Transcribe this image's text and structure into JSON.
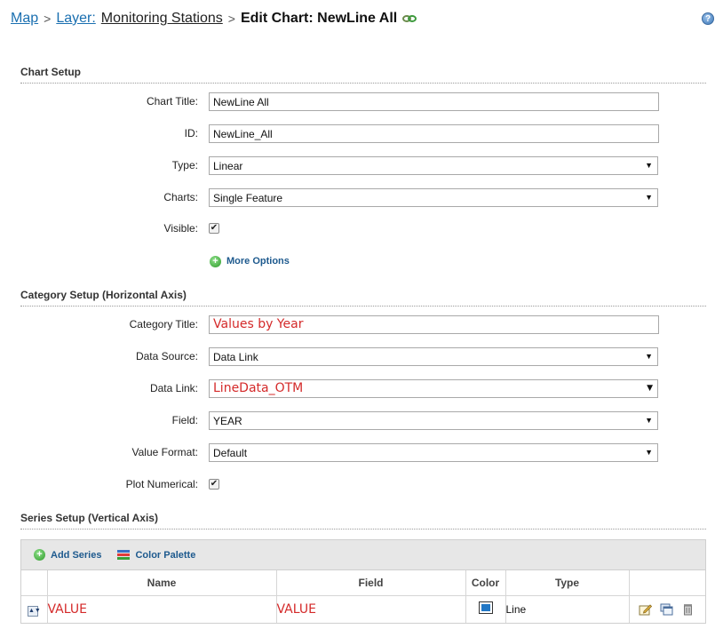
{
  "breadcrumb": {
    "map": "Map",
    "layer": "Layer:",
    "layer_name": "Monitoring Stations",
    "separator": ">",
    "current": "Edit Chart: NewLine All"
  },
  "help_glyph": "?",
  "chart_setup": {
    "heading": "Chart Setup",
    "title_label": "Chart Title:",
    "title_value": "NewLine All",
    "id_label": "ID:",
    "id_value": "NewLine_All",
    "type_label": "Type:",
    "type_value": "Linear",
    "charts_label": "Charts:",
    "charts_value": "Single Feature",
    "visible_label": "Visible:",
    "visible_checked": true,
    "more_options": "More Options"
  },
  "category_setup": {
    "heading": "Category Setup (Horizontal Axis)",
    "title_label": "Category Title:",
    "title_value": "Values by Year",
    "source_label": "Data Source:",
    "source_value": "Data Link",
    "link_label": "Data Link:",
    "link_value": "LineData_OTM",
    "field_label": "Field:",
    "field_value": "YEAR",
    "format_label": "Value Format:",
    "format_value": "Default",
    "plot_label": "Plot Numerical:",
    "plot_checked": true
  },
  "series_setup": {
    "heading": "Series Setup (Vertical Axis)",
    "add_series": "Add Series",
    "color_palette": "Color Palette",
    "columns": [
      "Name",
      "Field",
      "Color",
      "Type"
    ],
    "rows": [
      {
        "name": "VALUE",
        "field": "VALUE",
        "color": "#2277c5",
        "type": "Line"
      }
    ]
  },
  "icons": {
    "link": "link-icon",
    "help": "help-icon",
    "add": "plus-circle-icon",
    "palette": "color-palette-icon",
    "drag": "drag-handle-icon",
    "edit": "edit-icon",
    "copy": "copy-icon",
    "delete": "trash-icon"
  },
  "colors": {
    "link": "#1a6fb0",
    "accent_text": "#d42a2a",
    "toolbar_bg": "#e7e7e7"
  }
}
